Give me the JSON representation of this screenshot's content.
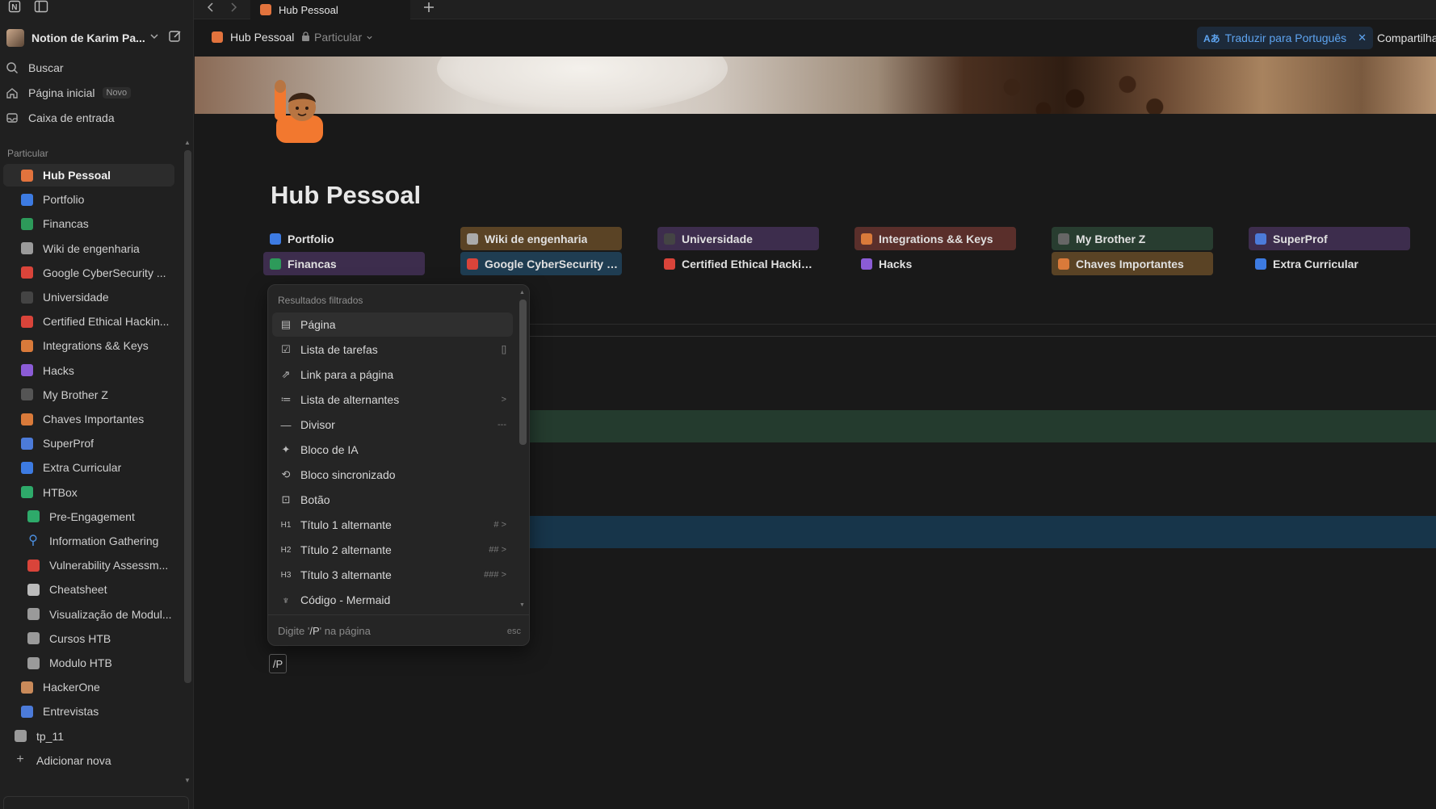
{
  "window": {
    "tab_title": "Hub Pessoal"
  },
  "sidebar": {
    "workspace": "Notion de Karim Pa...",
    "nav": [
      {
        "label": "Buscar",
        "icon": "search-icon"
      },
      {
        "label": "Página inicial",
        "icon": "home-icon",
        "badge": "Novo"
      },
      {
        "label": "Caixa de entrada",
        "icon": "inbox-icon"
      }
    ],
    "section_label": "Particular",
    "pages": [
      {
        "label": "Hub Pessoal",
        "icon": "hub-icon",
        "color": "#e2733d"
      },
      {
        "label": "Portfolio",
        "icon": "portfolio-icon",
        "color": "#3d7be2"
      },
      {
        "label": "Financas",
        "icon": "money-icon",
        "color": "#2d9a5a"
      },
      {
        "label": "Wiki de engenharia",
        "icon": "wiki-icon",
        "color": "#9a9a9a"
      },
      {
        "label": "Google CyberSecurity ...",
        "icon": "cyber-icon",
        "color": "#d9443a"
      },
      {
        "label": "Universidade",
        "icon": "graduation-icon",
        "color": "#444"
      },
      {
        "label": "Certified Ethical Hackin...",
        "icon": "hacker-icon",
        "color": "#d9443a"
      },
      {
        "label": "Integrations && Keys",
        "icon": "key-icon",
        "color": "#d97a3a"
      },
      {
        "label": "Hacks",
        "icon": "terminal-icon",
        "color": "#8b5cd6"
      },
      {
        "label": "My Brother Z",
        "icon": "alien-icon",
        "color": "#555"
      },
      {
        "label": "Chaves Importantes",
        "icon": "key-icon",
        "color": "#d97a3a"
      },
      {
        "label": "SuperProf",
        "icon": "avatar-icon",
        "color": "#4c7bd9"
      },
      {
        "label": "Extra Curricular",
        "icon": "laptop-icon",
        "color": "#3d7be2"
      },
      {
        "label": "HTBox",
        "icon": "cube-icon",
        "color": "#2eaa6a"
      }
    ],
    "subpages": [
      {
        "label": "Pre-Engagement",
        "icon": "handshake-icon",
        "color": "#2eaa6a"
      },
      {
        "label": "Information Gathering",
        "icon": "magnifier-icon",
        "color": "#4c8fe0"
      },
      {
        "label": "Vulnerability Assessm...",
        "icon": "bug-icon",
        "color": "#d9443a"
      },
      {
        "label": "Cheatsheet",
        "icon": "notepad-icon",
        "color": "#bbbbbb"
      },
      {
        "label": "Visualização de Modul...",
        "icon": "table-icon",
        "color": "#9a9a9a"
      },
      {
        "label": "Cursos HTB",
        "icon": "table-icon",
        "color": "#9a9a9a"
      },
      {
        "label": "Modulo HTB",
        "icon": "table-icon",
        "color": "#9a9a9a"
      }
    ],
    "tail": [
      {
        "label": "HackerOne",
        "icon": "person-icon",
        "color": "#c98a5a"
      },
      {
        "label": "Entrevistas",
        "icon": "interview-icon",
        "color": "#4c7bd9"
      },
      {
        "label": "tp_11",
        "icon": "page-icon",
        "color": "#9a9a9a"
      },
      {
        "label": "Adicionar nova",
        "icon": "plus-icon",
        "color": "#9a9a9a"
      }
    ]
  },
  "header": {
    "breadcrumb_page": "Hub Pessoal",
    "breadcrumb_privacy": "Particular",
    "translate_label": "Traduzir para Português",
    "share_label": "Compartilha"
  },
  "page": {
    "title": "Hub Pessoal",
    "links": [
      {
        "label": "Portfolio",
        "bg": "transparent",
        "icon_color": "#3d7be2"
      },
      {
        "label": "Wiki de engenharia",
        "bg": "#5a4325",
        "icon_color": "#aaaaaa"
      },
      {
        "label": "Universidade",
        "bg": "#3d2d4d",
        "icon_color": "#444"
      },
      {
        "label": "Integrations && Keys",
        "bg": "#5a2f2b",
        "icon_color": "#d97a3a"
      },
      {
        "label": "My Brother Z",
        "bg": "#283d30",
        "icon_color": "#666"
      },
      {
        "label": "SuperProf",
        "bg": "#3d2d4d",
        "icon_color": "#4c7bd9"
      },
      {
        "label": "Financas",
        "bg": "#3d2d4d",
        "icon_color": "#2d9a5a"
      },
      {
        "label": "Google CyberSecurity Ce...",
        "bg": "#1f3d52",
        "icon_color": "#d9443a"
      },
      {
        "label": "Certified Ethical Hacking ...",
        "bg": "transparent",
        "icon_color": "#d9443a"
      },
      {
        "label": "Hacks",
        "bg": "transparent",
        "icon_color": "#8b5cd6"
      },
      {
        "label": "Chaves Importantes",
        "bg": "#5a4325",
        "icon_color": "#d97a3a"
      },
      {
        "label": "Extra Curricular",
        "bg": "transparent",
        "icon_color": "#3d7be2"
      }
    ],
    "slash_text": "/P"
  },
  "slash_menu": {
    "heading": "Resultados filtrados",
    "items": [
      {
        "label": "Página",
        "icon": "page-icon",
        "shortcut": ""
      },
      {
        "label": "Lista de tarefas",
        "icon": "checklist-icon",
        "shortcut": "[]"
      },
      {
        "label": "Link para a página",
        "icon": "link-page-icon",
        "shortcut": ""
      },
      {
        "label": "Lista de alternantes",
        "icon": "toggle-list-icon",
        "shortcut": ">"
      },
      {
        "label": "Divisor",
        "icon": "divider-icon",
        "shortcut": "---"
      },
      {
        "label": "Bloco de IA",
        "icon": "ai-block-icon",
        "shortcut": ""
      },
      {
        "label": "Bloco sincronizado",
        "icon": "sync-block-icon",
        "shortcut": ""
      },
      {
        "label": "Botão",
        "icon": "button-icon",
        "shortcut": ""
      },
      {
        "label": "Título 1 alternante",
        "icon": "h1-toggle-icon",
        "shortcut": "# >"
      },
      {
        "label": "Título 2 alternante",
        "icon": "h2-toggle-icon",
        "shortcut": "## >"
      },
      {
        "label": "Título 3 alternante",
        "icon": "h3-toggle-icon",
        "shortcut": "### >"
      },
      {
        "label": "Código - Mermaid",
        "icon": "mermaid-icon",
        "shortcut": ""
      }
    ],
    "footer_prefix": "Digite '",
    "footer_query": "/P",
    "footer_suffix": "' na página",
    "footer_esc": "esc"
  }
}
